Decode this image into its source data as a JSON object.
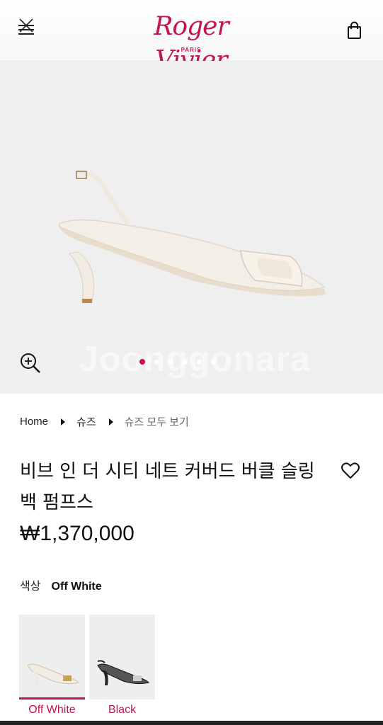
{
  "header": {
    "logo_script": "Roger Vivier",
    "logo_sub": "PARIS",
    "menu_icon": "menu-close-icon",
    "bag_icon": "shopping-bag-icon"
  },
  "hero": {
    "watermark": "Joonggonara",
    "slide_count": 6,
    "active_slide": 1
  },
  "breadcrumb": {
    "items": [
      "Home",
      "슈즈",
      "슈즈 모두 보기"
    ]
  },
  "product": {
    "title": "비브 인 더 시티 네트 커버드 버클 슬링백 펌프스",
    "price": "₩1,370,000",
    "color_label": "색상",
    "color_value": "Off White"
  },
  "swatches": [
    {
      "label": "Off White",
      "selected": true
    },
    {
      "label": "Black",
      "selected": false
    }
  ],
  "colors": {
    "accent": "#c4154a",
    "hero_bg": "#efefef"
  }
}
